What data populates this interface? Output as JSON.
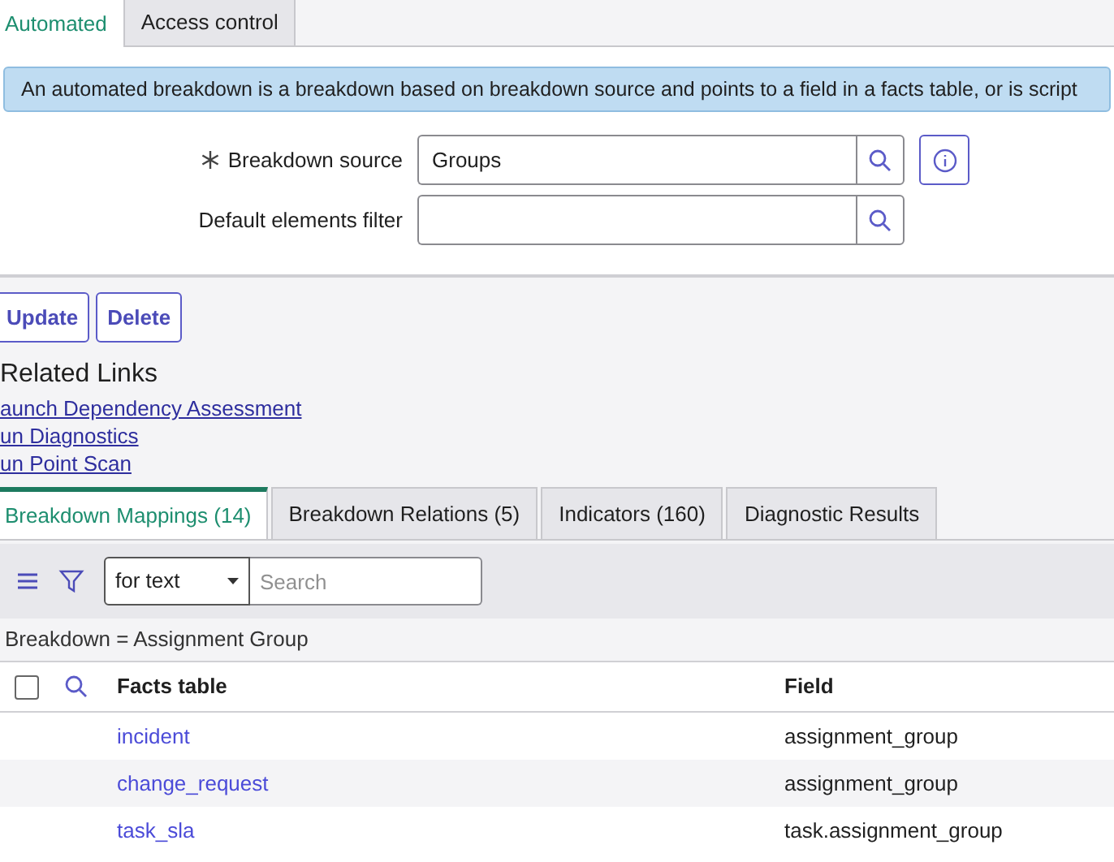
{
  "form_tabs": [
    {
      "label": "Automated",
      "selected": true
    },
    {
      "label": "Access control",
      "selected": false
    }
  ],
  "info_message": "An automated breakdown is a breakdown based on breakdown source and points to a field in a facts table, or is script",
  "fields": [
    {
      "label": "Breakdown source",
      "required": true,
      "value": "Groups",
      "info": true
    },
    {
      "label": "Default elements filter",
      "required": false,
      "info": false
    }
  ],
  "buttons": [
    "Update",
    "Delete"
  ],
  "related_links": {
    "title": "Related Links",
    "links": [
      "aunch Dependency Assessment",
      "un Diagnostics",
      "un Point Scan"
    ]
  },
  "related_tabs": [
    {
      "label": "Breakdown Mappings (14)",
      "selected": true
    },
    {
      "label": "Breakdown Relations (5)",
      "selected": false
    },
    {
      "label": "Indicators (160)",
      "selected": false
    },
    {
      "label": "Diagnostic Results",
      "selected": false
    }
  ],
  "list_toolbar": {
    "search_field": "for text",
    "search_placeholder": "Search"
  },
  "filter_breadcrumb": "Breakdown = Assignment Group",
  "table": {
    "select_all_checked": false,
    "columns": [
      "Facts table",
      "Field"
    ],
    "rows": [
      {
        "facts_table": "incident",
        "field": "assignment_group"
      },
      {
        "facts_table": "change_request",
        "field": "assignment_group"
      },
      {
        "facts_table": "task_sla",
        "field": "task.assignment_group"
      }
    ]
  }
}
